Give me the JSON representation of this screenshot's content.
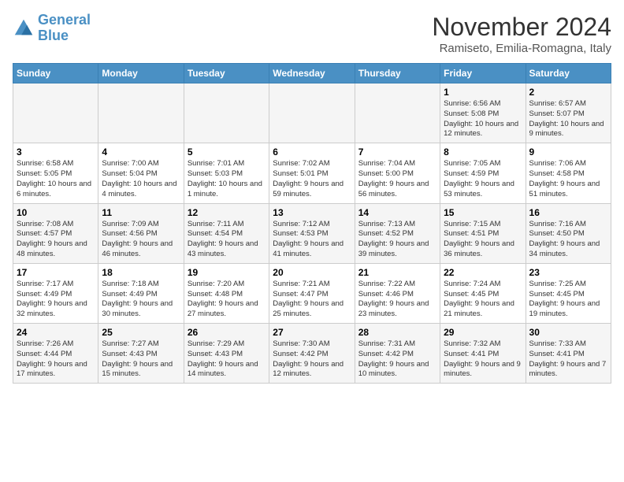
{
  "logo": {
    "text_general": "General",
    "text_blue": "Blue"
  },
  "header": {
    "month": "November 2024",
    "location": "Ramiseto, Emilia-Romagna, Italy"
  },
  "weekdays": [
    "Sunday",
    "Monday",
    "Tuesday",
    "Wednesday",
    "Thursday",
    "Friday",
    "Saturday"
  ],
  "weeks": [
    [
      {
        "day": "",
        "info": ""
      },
      {
        "day": "",
        "info": ""
      },
      {
        "day": "",
        "info": ""
      },
      {
        "day": "",
        "info": ""
      },
      {
        "day": "",
        "info": ""
      },
      {
        "day": "1",
        "info": "Sunrise: 6:56 AM\nSunset: 5:08 PM\nDaylight: 10 hours and 12 minutes."
      },
      {
        "day": "2",
        "info": "Sunrise: 6:57 AM\nSunset: 5:07 PM\nDaylight: 10 hours and 9 minutes."
      }
    ],
    [
      {
        "day": "3",
        "info": "Sunrise: 6:58 AM\nSunset: 5:05 PM\nDaylight: 10 hours and 6 minutes."
      },
      {
        "day": "4",
        "info": "Sunrise: 7:00 AM\nSunset: 5:04 PM\nDaylight: 10 hours and 4 minutes."
      },
      {
        "day": "5",
        "info": "Sunrise: 7:01 AM\nSunset: 5:03 PM\nDaylight: 10 hours and 1 minute."
      },
      {
        "day": "6",
        "info": "Sunrise: 7:02 AM\nSunset: 5:01 PM\nDaylight: 9 hours and 59 minutes."
      },
      {
        "day": "7",
        "info": "Sunrise: 7:04 AM\nSunset: 5:00 PM\nDaylight: 9 hours and 56 minutes."
      },
      {
        "day": "8",
        "info": "Sunrise: 7:05 AM\nSunset: 4:59 PM\nDaylight: 9 hours and 53 minutes."
      },
      {
        "day": "9",
        "info": "Sunrise: 7:06 AM\nSunset: 4:58 PM\nDaylight: 9 hours and 51 minutes."
      }
    ],
    [
      {
        "day": "10",
        "info": "Sunrise: 7:08 AM\nSunset: 4:57 PM\nDaylight: 9 hours and 48 minutes."
      },
      {
        "day": "11",
        "info": "Sunrise: 7:09 AM\nSunset: 4:56 PM\nDaylight: 9 hours and 46 minutes."
      },
      {
        "day": "12",
        "info": "Sunrise: 7:11 AM\nSunset: 4:54 PM\nDaylight: 9 hours and 43 minutes."
      },
      {
        "day": "13",
        "info": "Sunrise: 7:12 AM\nSunset: 4:53 PM\nDaylight: 9 hours and 41 minutes."
      },
      {
        "day": "14",
        "info": "Sunrise: 7:13 AM\nSunset: 4:52 PM\nDaylight: 9 hours and 39 minutes."
      },
      {
        "day": "15",
        "info": "Sunrise: 7:15 AM\nSunset: 4:51 PM\nDaylight: 9 hours and 36 minutes."
      },
      {
        "day": "16",
        "info": "Sunrise: 7:16 AM\nSunset: 4:50 PM\nDaylight: 9 hours and 34 minutes."
      }
    ],
    [
      {
        "day": "17",
        "info": "Sunrise: 7:17 AM\nSunset: 4:49 PM\nDaylight: 9 hours and 32 minutes."
      },
      {
        "day": "18",
        "info": "Sunrise: 7:18 AM\nSunset: 4:49 PM\nDaylight: 9 hours and 30 minutes."
      },
      {
        "day": "19",
        "info": "Sunrise: 7:20 AM\nSunset: 4:48 PM\nDaylight: 9 hours and 27 minutes."
      },
      {
        "day": "20",
        "info": "Sunrise: 7:21 AM\nSunset: 4:47 PM\nDaylight: 9 hours and 25 minutes."
      },
      {
        "day": "21",
        "info": "Sunrise: 7:22 AM\nSunset: 4:46 PM\nDaylight: 9 hours and 23 minutes."
      },
      {
        "day": "22",
        "info": "Sunrise: 7:24 AM\nSunset: 4:45 PM\nDaylight: 9 hours and 21 minutes."
      },
      {
        "day": "23",
        "info": "Sunrise: 7:25 AM\nSunset: 4:45 PM\nDaylight: 9 hours and 19 minutes."
      }
    ],
    [
      {
        "day": "24",
        "info": "Sunrise: 7:26 AM\nSunset: 4:44 PM\nDaylight: 9 hours and 17 minutes."
      },
      {
        "day": "25",
        "info": "Sunrise: 7:27 AM\nSunset: 4:43 PM\nDaylight: 9 hours and 15 minutes."
      },
      {
        "day": "26",
        "info": "Sunrise: 7:29 AM\nSunset: 4:43 PM\nDaylight: 9 hours and 14 minutes."
      },
      {
        "day": "27",
        "info": "Sunrise: 7:30 AM\nSunset: 4:42 PM\nDaylight: 9 hours and 12 minutes."
      },
      {
        "day": "28",
        "info": "Sunrise: 7:31 AM\nSunset: 4:42 PM\nDaylight: 9 hours and 10 minutes."
      },
      {
        "day": "29",
        "info": "Sunrise: 7:32 AM\nSunset: 4:41 PM\nDaylight: 9 hours and 9 minutes."
      },
      {
        "day": "30",
        "info": "Sunrise: 7:33 AM\nSunset: 4:41 PM\nDaylight: 9 hours and 7 minutes."
      }
    ]
  ]
}
